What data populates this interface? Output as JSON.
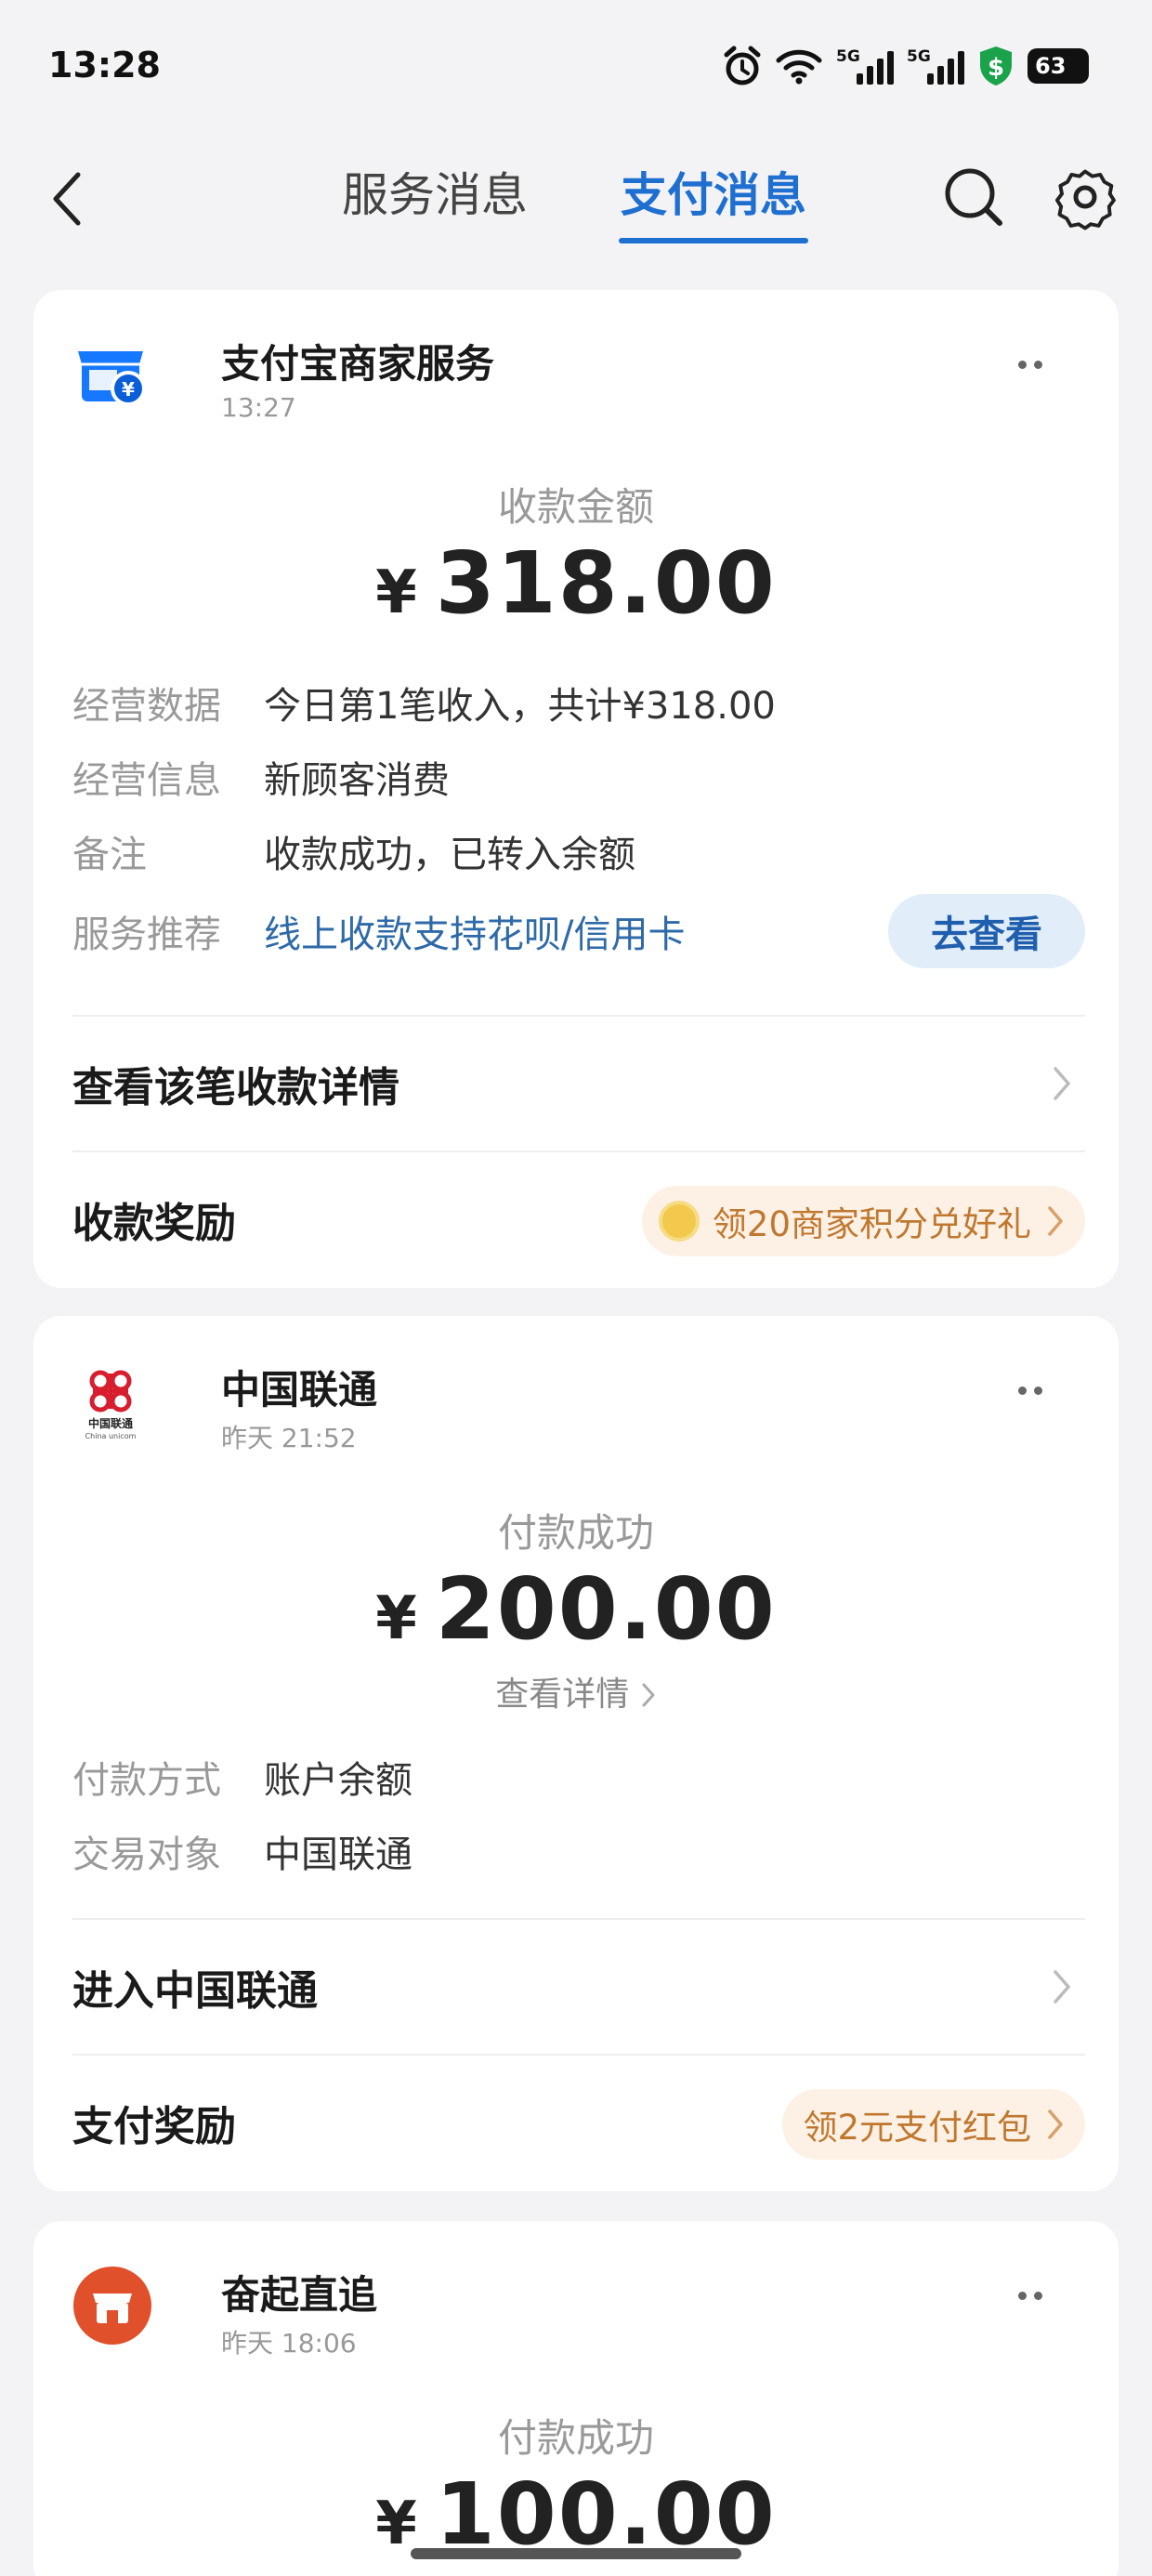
{
  "status": {
    "time": "13:28",
    "battery": "63",
    "net_tag_1": "5G",
    "net_tag_2": "5G"
  },
  "nav": {
    "tab_service": "服务消息",
    "tab_payment": "支付消息"
  },
  "card1": {
    "name": "支付宝商家服务",
    "time": "13:27",
    "subtitle": "收款金额",
    "currency": "¥",
    "amount": "318.00",
    "rows": [
      {
        "key": "经营数据",
        "value": "今日第1笔收入，共计¥318.00"
      },
      {
        "key": "经营信息",
        "value": "新顾客消费"
      },
      {
        "key": "备注",
        "value": "收款成功，已转入余额"
      },
      {
        "key": "服务推荐",
        "value": "线上收款支持花呗/信用卡"
      }
    ],
    "view_button": "去查看",
    "detail_action": "查看该笔收款详情",
    "reward_label": "收款奖励",
    "reward_pill": "领20商家积分兑好礼"
  },
  "card2": {
    "name": "中国联通",
    "logo_sub": "China unicom",
    "logo_cn": "中国联通",
    "time": "昨天 21:52",
    "subtitle": "付款成功",
    "currency": "¥",
    "amount": "200.00",
    "detail_link": "查看详情",
    "rows": [
      {
        "key": "付款方式",
        "value": "账户余额"
      },
      {
        "key": "交易对象",
        "value": "中国联通"
      }
    ],
    "enter_action": "进入中国联通",
    "reward_label": "支付奖励",
    "reward_pill": "领2元支付红包"
  },
  "card3": {
    "name": "奋起直追",
    "time": "昨天 18:06",
    "subtitle": "付款成功",
    "currency": "¥",
    "amount": "100.00"
  },
  "colors": {
    "accent": "#1f6fd1",
    "link": "#2e6aa8",
    "reward_text": "#c0782f",
    "unicom_red": "#d71e2f",
    "store_orange": "#e0502a"
  }
}
